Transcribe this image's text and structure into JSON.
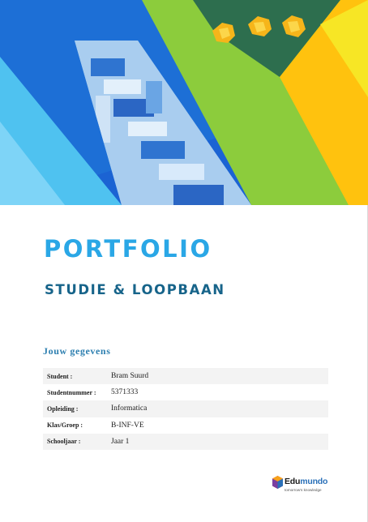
{
  "cover": {
    "title": "PORTFOLIO",
    "subtitle": "STUDIE & LOOPBAAN"
  },
  "details": {
    "heading": "Jouw gegevens",
    "rows": [
      {
        "label": "Student :",
        "value": "Bram Suurd"
      },
      {
        "label": "Studentnummer :",
        "value": "5371333"
      },
      {
        "label": "Opleiding :",
        "value": "Informatica"
      },
      {
        "label": "Klas/Groep :",
        "value": "B-INF-VE"
      },
      {
        "label": "Schooljaar :",
        "value": "Jaar 1"
      }
    ]
  },
  "logo": {
    "name_a": "Edu",
    "name_b": "mundo",
    "tagline": "tomorrow's knowledge"
  },
  "colors": {
    "title": "#2aa7e6",
    "subtitle": "#17648a",
    "heading": "#2d7fb0",
    "brand_blue": "#2a70b8",
    "band_green": "#8ccc3c",
    "band_yellow": "#ffc20e",
    "band_dark_green": "#2d6e4e",
    "band_blue": "#1d6fd6"
  }
}
